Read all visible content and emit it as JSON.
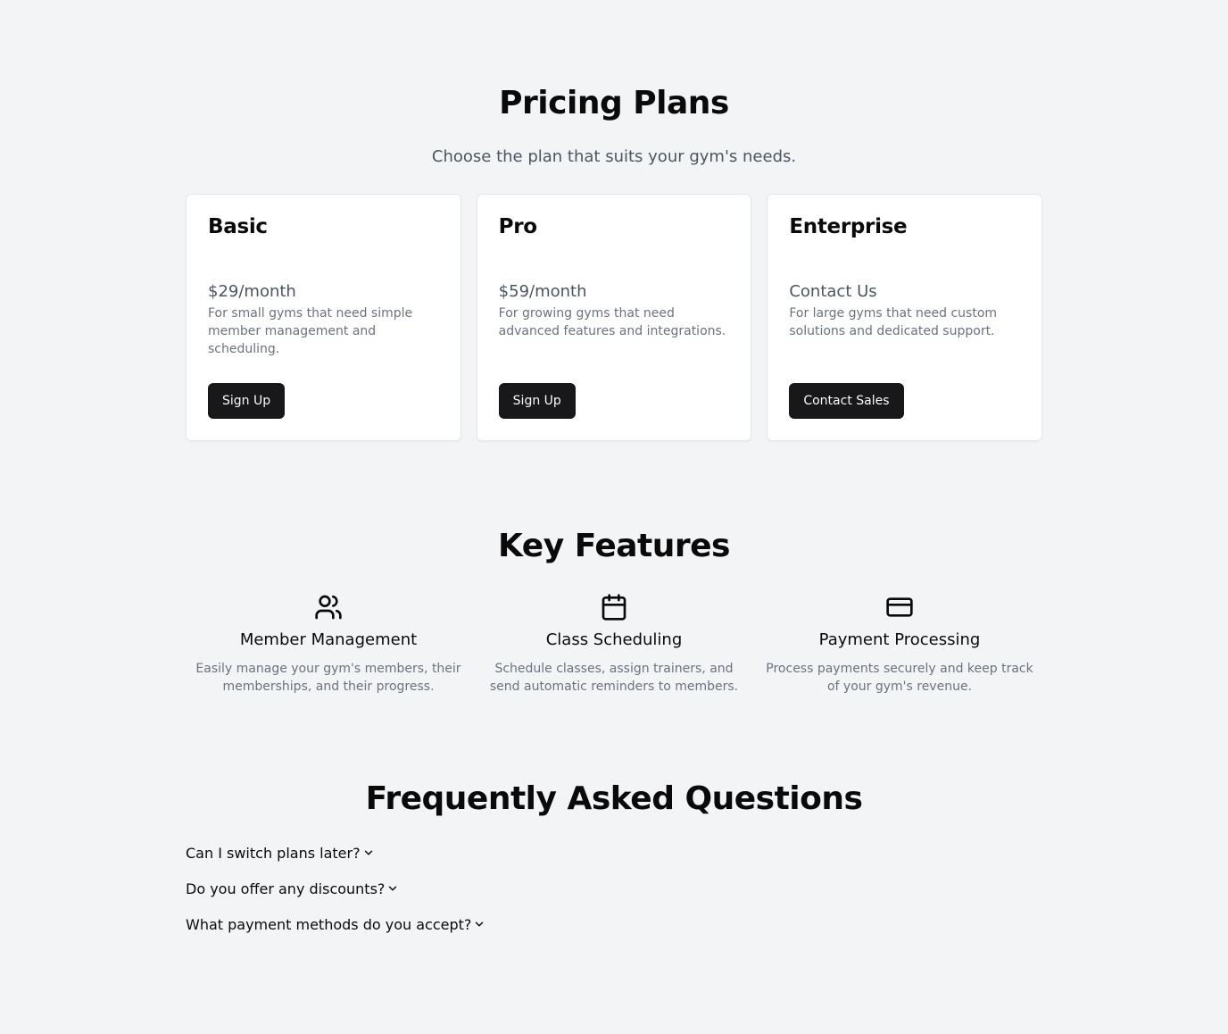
{
  "pricing": {
    "title": "Pricing Plans",
    "subtitle": "Choose the plan that suits your gym's needs.",
    "plans": [
      {
        "name": "Basic",
        "price": "$29/month",
        "description": "For small gyms that need simple member management and scheduling.",
        "button": "Sign Up"
      },
      {
        "name": "Pro",
        "price": "$59/month",
        "description": "For growing gyms that need advanced features and integrations.",
        "button": "Sign Up"
      },
      {
        "name": "Enterprise",
        "price": "Contact Us",
        "description": "For large gyms that need custom solutions and dedicated support.",
        "button": "Contact Sales"
      }
    ]
  },
  "features": {
    "title": "Key Features",
    "items": [
      {
        "icon": "users-icon",
        "title": "Member Management",
        "description": "Easily manage your gym's members, their memberships, and their progress."
      },
      {
        "icon": "calendar-icon",
        "title": "Class Scheduling",
        "description": "Schedule classes, assign trainers, and send automatic reminders to members."
      },
      {
        "icon": "credit-card-icon",
        "title": "Payment Processing",
        "description": "Process payments securely and keep track of your gym's revenue."
      }
    ]
  },
  "faq": {
    "title": "Frequently Asked Questions",
    "items": [
      {
        "question": "Can I switch plans later?"
      },
      {
        "question": "Do you offer any discounts?"
      },
      {
        "question": "What payment methods do you accept?"
      }
    ]
  },
  "colors": {
    "background": "#f3f4f6",
    "card": "#ffffff",
    "button": "#18181b",
    "muted_text": "#6b7280"
  }
}
